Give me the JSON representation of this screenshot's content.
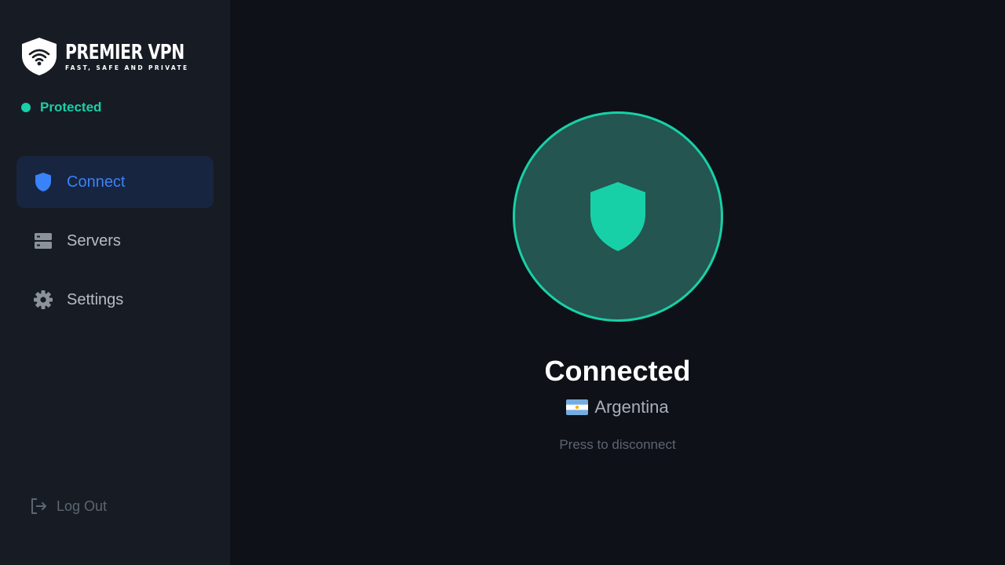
{
  "brand": {
    "name": "PREMIER VPN",
    "tagline": "FAST, SAFE AND PRIVATE"
  },
  "status": {
    "label": "Protected",
    "color": "#18d0a7"
  },
  "nav": {
    "items": [
      {
        "label": "Connect",
        "icon": "shield-icon",
        "active": true
      },
      {
        "label": "Servers",
        "icon": "server-icon",
        "active": false
      },
      {
        "label": "Settings",
        "icon": "gear-icon",
        "active": false
      }
    ],
    "logout_label": "Log Out"
  },
  "connection": {
    "state": "Connected",
    "country": "Argentina",
    "hint": "Press to disconnect"
  },
  "colors": {
    "accent": "#18d0a7",
    "active_nav": "#3a82f7",
    "sidebar_bg": "#171c24",
    "main_bg": "#0e1117"
  }
}
